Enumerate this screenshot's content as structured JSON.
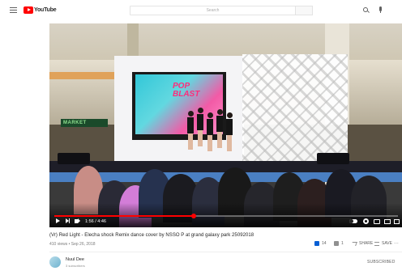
{
  "header": {
    "logo_text": "YouTube",
    "search_placeholder": "Search"
  },
  "player": {
    "time": "1:56 / 4:46",
    "progress_fraction": 0.405,
    "market_sign": "MARKET",
    "screen_text": "POP BLAST"
  },
  "video": {
    "title": "(Vr) Red Light - Elecha shock Remix dance cover by NSSO P at grand galaxy park 25092018",
    "meta": "410 views • Sep 26, 2018",
    "likes": "14",
    "dislikes": "1",
    "share_label": "SHARE",
    "save_label": "SAVE",
    "more_label": "..."
  },
  "channel": {
    "name": "Nuul Dee",
    "subscribers": "3 subscribers",
    "subscribe_label": "SUBSCRIBED"
  },
  "colors": {
    "accent": "#ff0000",
    "like": "#065fd4"
  }
}
